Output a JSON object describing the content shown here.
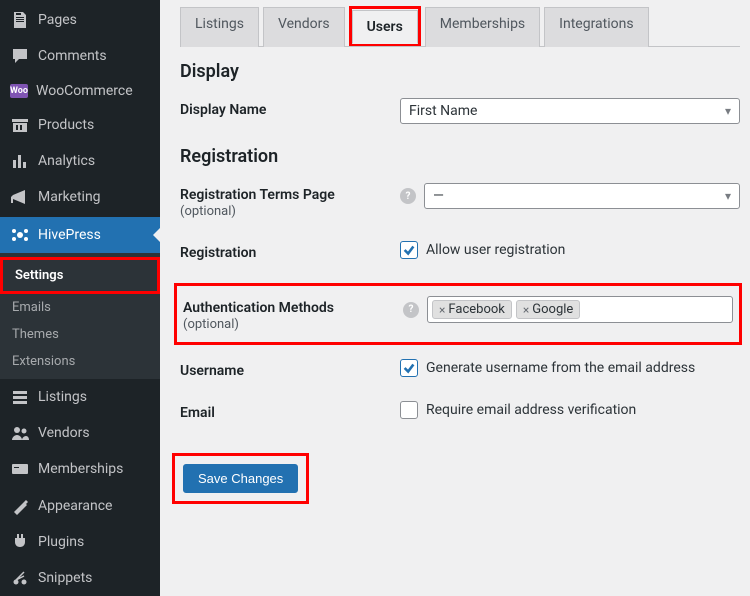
{
  "sidebar": {
    "pages": "Pages",
    "comments": "Comments",
    "woocommerce": "WooCommerce",
    "woo_badge": "Woo",
    "products": "Products",
    "analytics": "Analytics",
    "marketing": "Marketing",
    "hivepress": "HivePress",
    "settings": "Settings",
    "emails": "Emails",
    "themes": "Themes",
    "extensions": "Extensions",
    "listings": "Listings",
    "vendors": "Vendors",
    "memberships": "Memberships",
    "appearance": "Appearance",
    "plugins": "Plugins",
    "snippets": "Snippets"
  },
  "tabs": {
    "listings": "Listings",
    "vendors": "Vendors",
    "users": "Users",
    "memberships": "Memberships",
    "integrations": "Integrations"
  },
  "sections": {
    "display": "Display",
    "registration": "Registration"
  },
  "fields": {
    "display_name": {
      "label": "Display Name",
      "value": "First Name"
    },
    "reg_terms": {
      "label": "Registration Terms Page",
      "optional": "(optional)",
      "value": "—"
    },
    "registration": {
      "label": "Registration",
      "checkbox_label": "Allow user registration"
    },
    "auth_methods": {
      "label": "Authentication Methods",
      "optional": "(optional)",
      "tokens": [
        "Facebook",
        "Google"
      ]
    },
    "username": {
      "label": "Username",
      "checkbox_label": "Generate username from the email address"
    },
    "email": {
      "label": "Email",
      "checkbox_label": "Require email address verification"
    }
  },
  "buttons": {
    "save": "Save Changes"
  }
}
